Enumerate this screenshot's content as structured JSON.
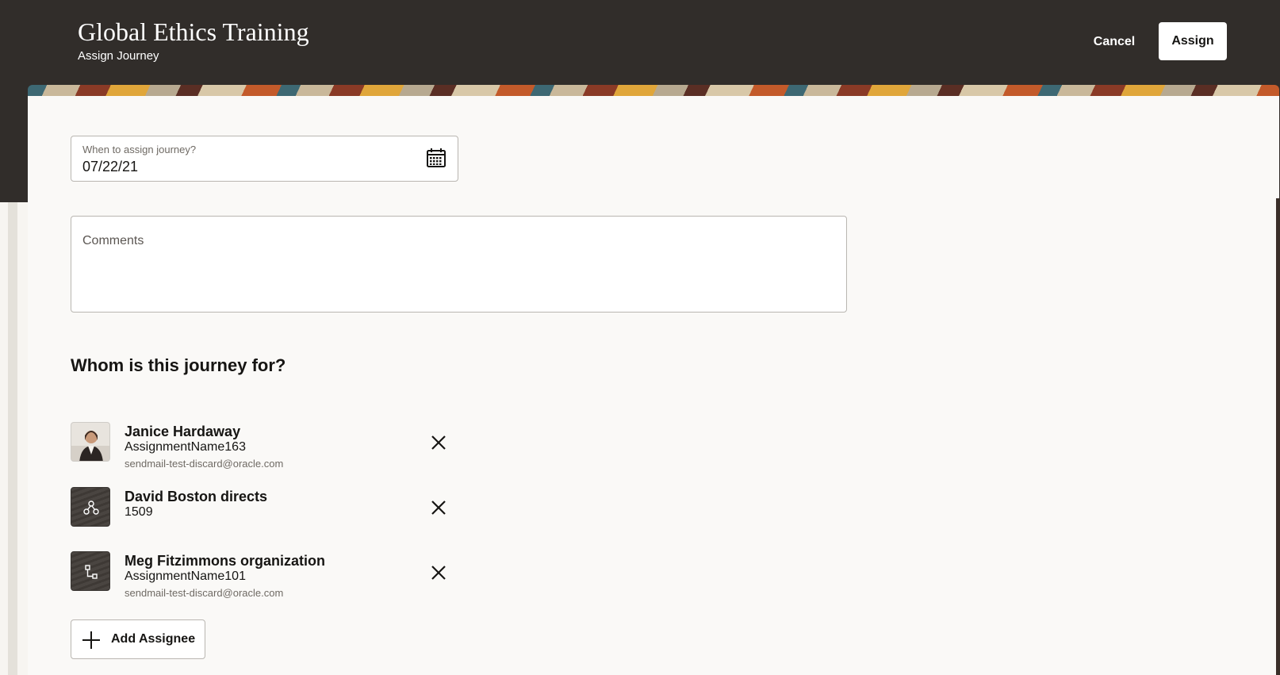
{
  "header": {
    "title": "Global Ethics Training",
    "subtitle": "Assign Journey",
    "cancel_label": "Cancel",
    "assign_label": "Assign"
  },
  "form": {
    "date_label": "When to assign journey?",
    "date_value": "07/22/21",
    "comments_label": "Comments",
    "comments_value": ""
  },
  "assignees_section": {
    "heading": "Whom is this journey for?",
    "items": [
      {
        "name": "Janice Hardaway",
        "detail": "AssignmentName163",
        "email": "sendmail-test-discard@oracle.com",
        "avatar": "person-photo"
      },
      {
        "name": "David Boston directs",
        "detail": "1509",
        "email": "",
        "avatar": "directs-icon"
      },
      {
        "name": "Meg Fitzimmons organization",
        "detail": "AssignmentName101",
        "email": "sendmail-test-discard@oracle.com",
        "avatar": "organization-icon"
      }
    ],
    "add_label": "Add Assignee"
  },
  "colors": {
    "header_bg": "#312d2a",
    "panel_bg": "#faf9f7",
    "text": "#161513",
    "muted": "#6f6a64"
  }
}
